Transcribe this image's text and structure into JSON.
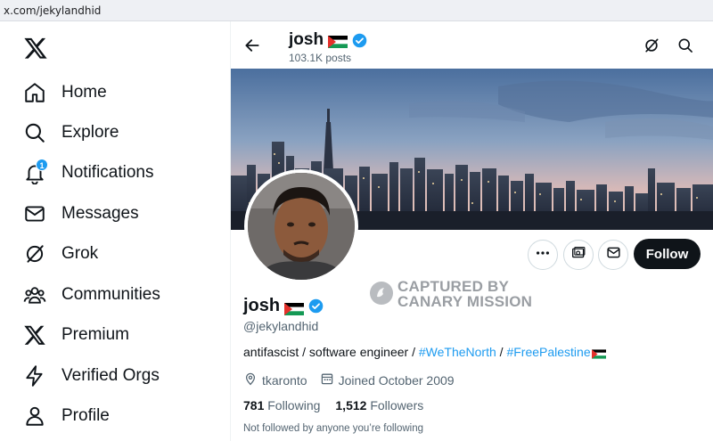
{
  "browser": {
    "url": "x.com/jekylandhid"
  },
  "sidebar": {
    "logo": "x-logo-icon",
    "items": [
      {
        "label": "Home",
        "icon": "home-icon"
      },
      {
        "label": "Explore",
        "icon": "search-icon"
      },
      {
        "label": "Notifications",
        "icon": "bell-icon",
        "badge": "1"
      },
      {
        "label": "Messages",
        "icon": "mail-icon"
      },
      {
        "label": "Grok",
        "icon": "grok-icon"
      },
      {
        "label": "Communities",
        "icon": "people-icon"
      },
      {
        "label": "Premium",
        "icon": "x-icon"
      },
      {
        "label": "Verified Orgs",
        "icon": "lightning-icon"
      },
      {
        "label": "Profile",
        "icon": "person-icon"
      }
    ]
  },
  "header": {
    "name": "josh",
    "posts": "103.1K posts"
  },
  "profile": {
    "name": "josh",
    "handle": "@jekylandhid",
    "bio_text": "antifascist / software engineer / ",
    "bio_tag1": "#WeTheNorth",
    "bio_sep": " / ",
    "bio_tag2": "#FreePalestine",
    "location": "tkaronto",
    "joined": "Joined October 2009",
    "following_count": "781",
    "following_label": "Following",
    "followers_count": "1,512",
    "followers_label": "Followers",
    "mutual_note": "Not followed by anyone you’re following",
    "follow_button": "Follow"
  },
  "watermark": {
    "line1": "CAPTURED BY",
    "line2": "CANARY MISSION"
  },
  "colors": {
    "accent": "#1d9bf0",
    "text": "#0f1419",
    "muted": "#536471",
    "follow_bg": "#0f1419"
  }
}
